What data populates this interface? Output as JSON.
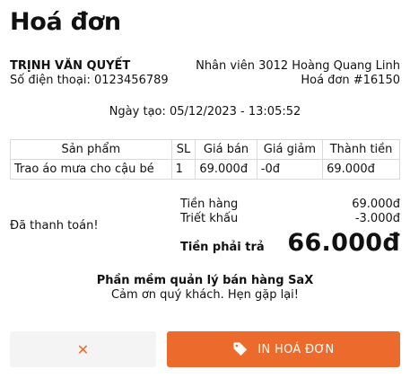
{
  "title": "Hoá đơn",
  "customer": {
    "name": "TRỊNH VĂN QUYẾT",
    "phone": "Số điện thoại: 0123456789"
  },
  "staff": "Nhân viên 3012 Hoàng Quang Linh",
  "invoice_no": "Hoá đơn #16150",
  "created": "Ngày tạo: 05/12/2023 - 13:05:52",
  "table": {
    "headers": [
      "Sản phẩm",
      "SL",
      "Giá bán",
      "Giá giảm",
      "Thành tiền"
    ],
    "rows": [
      [
        "Trao áo mưa cho cậu bé",
        "1",
        "69.000đ",
        "-0đ",
        "69.000đ"
      ]
    ]
  },
  "payment_status": "Đã thanh toán!",
  "summary": {
    "subtotal_label": "Tiền hàng",
    "subtotal": "69.000đ",
    "discount_label": "Triết khấu",
    "discount": "-3.000đ",
    "total_label": "Tiền phải trả",
    "total": "66.000đ"
  },
  "footer": {
    "brand": "Phần mềm quản lý bán hàng SaX",
    "thanks": "Cảm ơn quý khách. Hẹn gặp lại!"
  },
  "buttons": {
    "close_icon": "close-icon",
    "close_symbol": "✕",
    "print_label": "IN HOÁ ĐƠN",
    "print_icon": "tag-icon"
  },
  "colors": {
    "accent": "#ec6a2c",
    "close_bg": "#f4f4f4"
  }
}
